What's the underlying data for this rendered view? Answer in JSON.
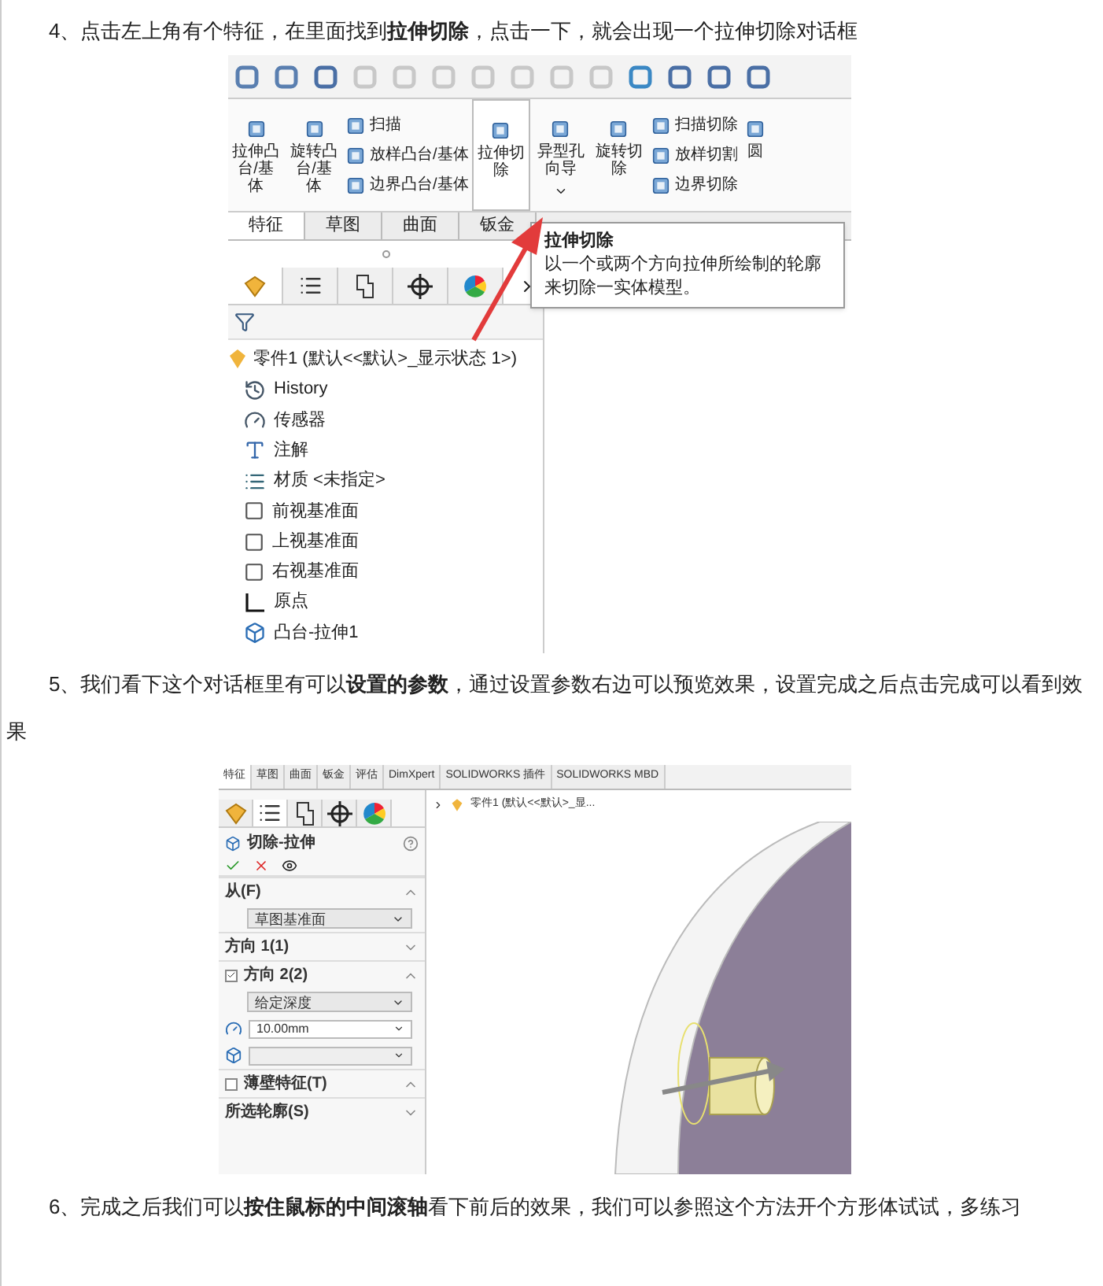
{
  "step4": {
    "text": "4、点击左上角有个特征，在里面找到**拉伸切除**，点击一下，就会出现一个拉伸切除对话框"
  },
  "figure1": {
    "commands": [
      {
        "kind": "large",
        "label": "拉伸凸台/基体",
        "selected": false,
        "dropdown": false
      },
      {
        "kind": "large",
        "label": "旋转凸台/基体",
        "selected": false,
        "dropdown": false
      },
      {
        "kind": "stack",
        "items": [
          "扫描",
          "放样凸台/基体",
          "边界凸台/基体"
        ]
      },
      {
        "kind": "large",
        "label": "拉伸切除",
        "selected": true,
        "dropdown": false
      },
      {
        "kind": "large",
        "label": "异型孔向导",
        "selected": false,
        "dropdown": true
      },
      {
        "kind": "large",
        "label": "旋转切除",
        "selected": false,
        "dropdown": false
      },
      {
        "kind": "stack",
        "items": [
          "扫描切除",
          "放样切割",
          "边界切除"
        ]
      },
      {
        "kind": "large",
        "label": "圆",
        "selected": false,
        "dropdown": false
      }
    ],
    "tabs": [
      {
        "label": "特征",
        "selected": true
      },
      {
        "label": "草图",
        "selected": false
      },
      {
        "label": "曲面",
        "selected": false
      },
      {
        "label": "钣金",
        "selected": false
      }
    ],
    "tooltip": {
      "title": "拉伸切除",
      "text": "以一个或两个方向拉伸所绘制的轮廓来切除一实体模型。"
    },
    "panel_tabs": [
      {
        "kind": "feature",
        "selected": true
      },
      {
        "kind": "property",
        "selected": false
      },
      {
        "kind": "config",
        "selected": false
      },
      {
        "kind": "target",
        "selected": false
      },
      {
        "kind": "display",
        "selected": false
      }
    ],
    "tree": {
      "label": "零件1 (默认<<默认>_显示状态 1>)",
      "children": [
        {
          "kind": "history",
          "label": "History"
        },
        {
          "kind": "sensor",
          "label": "传感器"
        },
        {
          "kind": "annotation",
          "label": "注解"
        },
        {
          "kind": "material",
          "label": "材质 <未指定>"
        },
        {
          "kind": "plane",
          "label": "前视基准面"
        },
        {
          "kind": "plane",
          "label": "上视基准面"
        },
        {
          "kind": "plane",
          "label": "右视基准面"
        },
        {
          "kind": "origin",
          "label": "原点"
        },
        {
          "kind": "feature",
          "label": "凸台-拉伸1"
        }
      ]
    }
  },
  "step5": {
    "text": "5、我们看下这个对话框里有可以**设置的参数**，通过设置参数右边可以预览效果，设置完成之后点击完成可以看到效果"
  },
  "figure2": {
    "tabs": [
      {
        "label": "特征",
        "selected": true
      },
      {
        "label": "草图",
        "selected": false
      },
      {
        "label": "曲面",
        "selected": false
      },
      {
        "label": "钣金",
        "selected": false
      },
      {
        "label": "评估",
        "selected": false
      },
      {
        "label": "DimXpert",
        "selected": false
      },
      {
        "label": "SOLIDWORKS 插件",
        "selected": false
      },
      {
        "label": "SOLIDWORKS MBD",
        "selected": false
      }
    ],
    "panel_tabs": [
      {
        "kind": "feature",
        "selected": false
      },
      {
        "kind": "property",
        "selected": true
      },
      {
        "kind": "config",
        "selected": false
      },
      {
        "kind": "target",
        "selected": false
      },
      {
        "kind": "display",
        "selected": false
      }
    ],
    "title": "切除-拉伸",
    "rows": [
      {
        "kind": "section",
        "label": "从(F)",
        "expanded": true
      },
      {
        "kind": "select",
        "value": "草图基准面"
      },
      {
        "kind": "section",
        "label": "方向 1(1)",
        "expanded": false
      },
      {
        "kind": "check_section",
        "label": "方向 2(2)",
        "checked": true,
        "expanded": true
      },
      {
        "kind": "select",
        "value": "给定深度"
      },
      {
        "kind": "number",
        "value": "10.00mm"
      },
      {
        "kind": "empty_number"
      },
      {
        "kind": "check_section",
        "label": "薄壁特征(T)",
        "checked": false,
        "expanded": true
      },
      {
        "kind": "section",
        "label": "所选轮廓(S)",
        "expanded": false
      }
    ],
    "tree_item": "零件1 (默认<<默认>_显..."
  },
  "step6": {
    "text": "6、完成之后我们可以**按住鼠标的中间滚轴**看下前后的效果，我们可以参照这个方法开个方形体试试，多练习"
  }
}
